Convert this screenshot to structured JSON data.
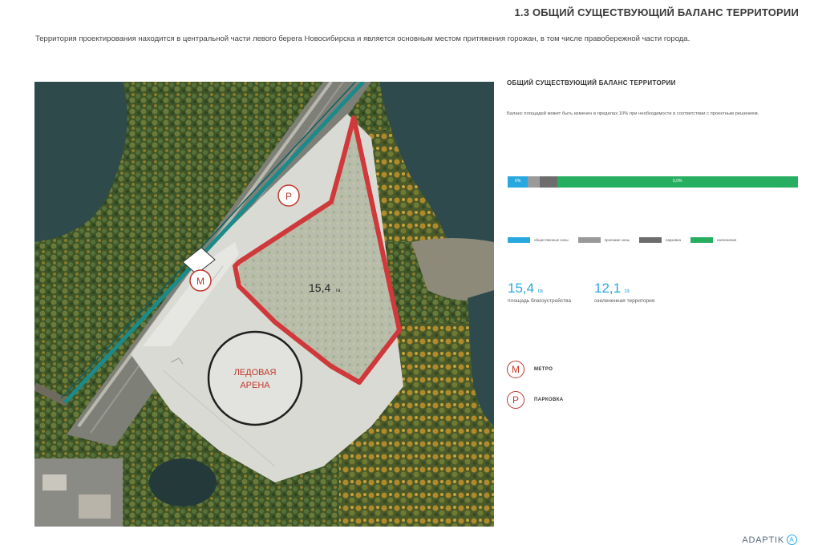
{
  "header": {
    "title": "1.3 ОБЩИЙ СУЩЕСТВУЮЩИЙ БАЛАНС ТЕРРИТОРИИ"
  },
  "intro": {
    "text": "Территория проектирования находится в центральной части левого берега Новосибирска и является основным местом притяжения горожан, в том числе правобережной части города."
  },
  "map": {
    "area_value": "15,4",
    "area_unit": "га",
    "arena_line1": "ЛЕДОВАЯ",
    "arena_line2": "АРЕНА",
    "metro_marker": "M",
    "parking_marker": "P",
    "colors": {
      "boundary": "#d0393b",
      "rail": "#1a8a8a",
      "water": "#2e4a4a",
      "forest": "#3f5a2a"
    }
  },
  "side": {
    "title": "ОБЩИЙ СУЩЕСТВУЮЩИЙ БАЛАНС ТЕРРИТОРИИ",
    "note": "Баланс площадей может быть изменен в пределах 10% при необходимости в соответствии с проектным решением."
  },
  "balance_bar": [
    {
      "label": "0%",
      "fraction": 0.07,
      "color": "#29a8df"
    },
    {
      "label": "",
      "fraction": 0.04,
      "color": "#9a9a9a"
    },
    {
      "label": "",
      "fraction": 0.06,
      "color": "#6d6d6d"
    },
    {
      "label": "0,0%",
      "fraction": 0.83,
      "color": "#27ae60"
    }
  ],
  "legend": [
    {
      "label": "общественные зоны",
      "color": "#29a8df"
    },
    {
      "label": "проезжие зоны",
      "color": "#9a9a9a"
    },
    {
      "label": "парковка",
      "color": "#6d6d6d"
    },
    {
      "label": "озеленение",
      "color": "#27ae60"
    }
  ],
  "stats": [
    {
      "value": "15,4",
      "unit": "га",
      "label": "площадь благоустройства"
    },
    {
      "value": "12,1",
      "unit": "га",
      "label": "озелененная территория"
    }
  ],
  "icons": [
    {
      "glyph": "M",
      "label": "МЕТРО"
    },
    {
      "glyph": "P",
      "label": "ПАРКОВКА"
    }
  ],
  "brand": {
    "name": "ADAPTIK",
    "mark": "A"
  }
}
